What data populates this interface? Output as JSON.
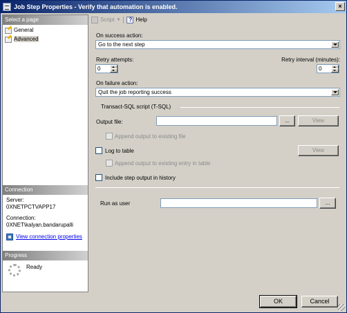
{
  "window": {
    "title": "Job Step Properties - Verify that automation is enabled.",
    "close_label": "×"
  },
  "left_pane": {
    "header": "Select a page",
    "pages": [
      {
        "label": "General",
        "selected": false
      },
      {
        "label": "Advanced",
        "selected": true
      }
    ],
    "connection": {
      "header": "Connection",
      "server_label": "Server:",
      "server_value": "0XNETPCTVAPP17",
      "connection_label": "Connection:",
      "connection_value": "0XNET\\kalyan.bandarupalli",
      "link_label": "View connection properties"
    },
    "progress": {
      "header": "Progress",
      "status": "Ready"
    }
  },
  "toolbar": {
    "script_label": "Script",
    "help_label": "Help"
  },
  "form": {
    "on_success_label": "On success action:",
    "on_success_value": "Go to the next step",
    "retry_attempts_label": "Retry attempts:",
    "retry_attempts_value": "0",
    "retry_interval_label": "Retry interval (minutes):",
    "retry_interval_value": "0",
    "on_failure_label": "On failure action:",
    "on_failure_value": "Quit the job reporting success",
    "tsql_group_label": "Transact-SQL script (T-SQL)",
    "output_file_label": "Output file:",
    "output_file_value": "",
    "browse_label": "...",
    "view_label": "View",
    "append_output_label": "Append output to existing file",
    "log_to_table_label": "Log to table",
    "view_table_label": "View",
    "append_table_label": "Append output to existing entry in table",
    "include_history_label": "Include step output in history",
    "run_as_label": "Run as user",
    "run_as_value": "",
    "run_as_browse_label": "..."
  },
  "footer": {
    "ok_label": "OK",
    "cancel_label": "Cancel"
  }
}
